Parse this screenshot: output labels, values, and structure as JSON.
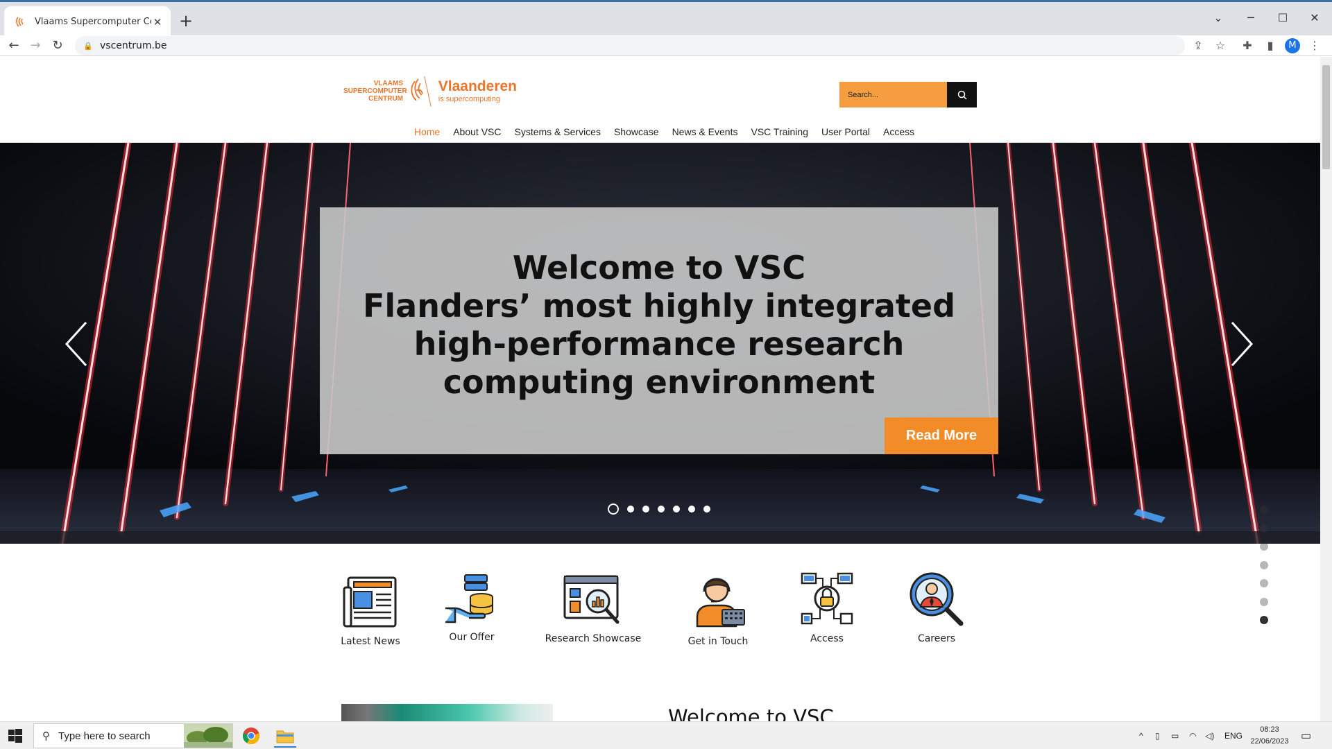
{
  "browser": {
    "tab_title": "Vlaams Supercomputer Centrum",
    "tab_close": "✕",
    "new_tab": "+",
    "url": "vscentrum.be",
    "profile_initial": "M"
  },
  "site": {
    "logo": {
      "vsc_line1": "VLAAMS",
      "vsc_line2": "SUPERCOMPUTER",
      "vsc_line3": "CENTRUM",
      "brand": "Vlaanderen",
      "tagline": "is supercomputing"
    },
    "search": {
      "placeholder": "Search..."
    },
    "nav": [
      {
        "label": "Home",
        "active": true
      },
      {
        "label": "About VSC"
      },
      {
        "label": "Systems & Services"
      },
      {
        "label": "Showcase"
      },
      {
        "label": "News & Events"
      },
      {
        "label": "VSC Training"
      },
      {
        "label": "User Portal"
      },
      {
        "label": "Access"
      }
    ],
    "hero": {
      "line1": "Welcome to VSC",
      "line2": "Flanders’ most highly integrated",
      "line3": "high-performance research",
      "line4": "computing environment",
      "cta": "Read More",
      "slide_count": 7,
      "active_slide": 1
    },
    "tiles": [
      {
        "label": "Latest News",
        "icon": "newspaper-icon"
      },
      {
        "label": "Our Offer",
        "icon": "hand-database-icon"
      },
      {
        "label": "Research Showcase",
        "icon": "analytics-magnifier-icon"
      },
      {
        "label": "Get in Touch",
        "icon": "support-agent-icon"
      },
      {
        "label": "Access",
        "icon": "network-lock-icon"
      },
      {
        "label": "Careers",
        "icon": "person-search-icon"
      }
    ],
    "section_heading": "Welcome to VSC"
  },
  "taskbar": {
    "search_placeholder": "Type here to search",
    "language": "ENG",
    "time": "08:23",
    "date": "22/06/2023"
  },
  "colors": {
    "accent_orange": "#e8762b",
    "search_bg": "#f59d3f",
    "cta_bg": "#f28c28"
  }
}
